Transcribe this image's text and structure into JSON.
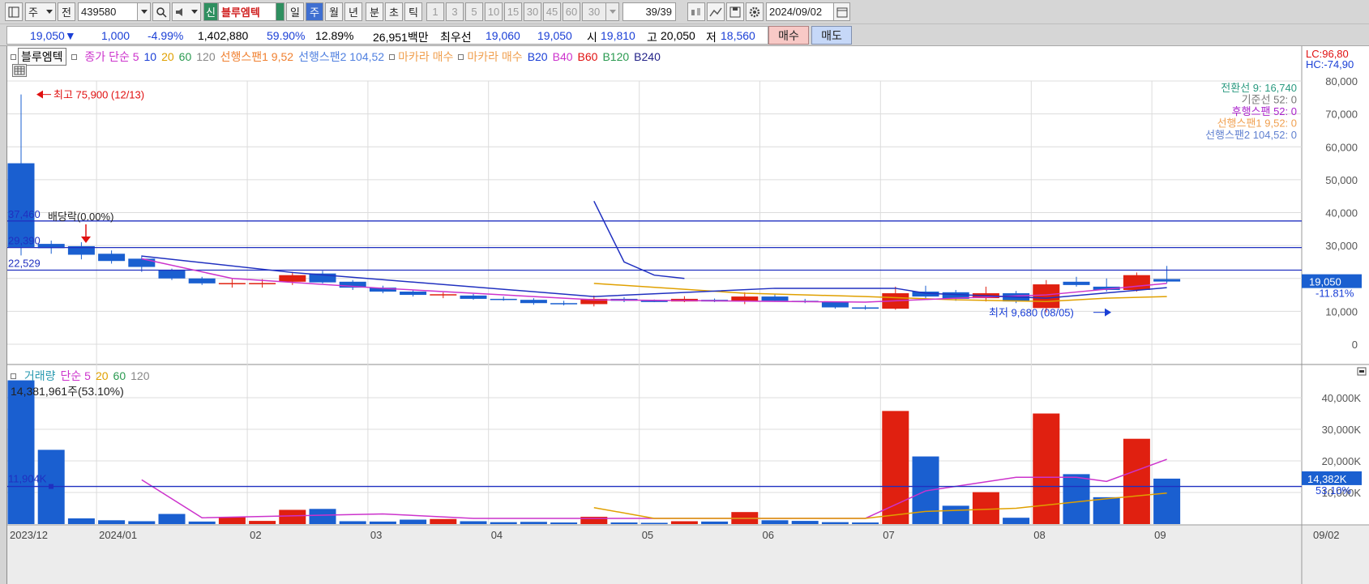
{
  "toolbar": {
    "period_select": "주",
    "prev_label": "전",
    "code": "439580",
    "badge": "신",
    "stock_name": "블루엠텍",
    "period_tabs": [
      "일",
      "주",
      "월",
      "년",
      "분",
      "초",
      "틱"
    ],
    "active_tab": "주",
    "intervals": [
      "1",
      "3",
      "5",
      "10",
      "15",
      "30",
      "45",
      "60"
    ],
    "count_select": "30",
    "page_count": "39/39",
    "date": "2024/09/02"
  },
  "info": {
    "price": "19,050▼",
    "change": "1,000",
    "change_pct": "-4.99%",
    "volume": "1,402,880",
    "ratio1": "59.90%",
    "ratio2": "12.89%",
    "amount": "26,951백만",
    "best_label": "최우선",
    "best_ask": "19,060",
    "best_bid": "19,050",
    "open_label": "시",
    "open": "19,810",
    "high_label": "고",
    "high": "20,050",
    "low_label": "저",
    "low": "18,560",
    "buy_button": "매수",
    "sell_button": "매도"
  },
  "price_legend": {
    "title": "블루엠텍",
    "items": [
      {
        "text": "종가 단순 5",
        "color": "#cc33cc"
      },
      {
        "text": "10",
        "color": "#1a3fd6"
      },
      {
        "text": "20",
        "color": "#e0a000"
      },
      {
        "text": "60",
        "color": "#2a9a50"
      },
      {
        "text": "120",
        "color": "#888888"
      },
      {
        "text": "선행스팬1 9,52",
        "color": "#f08030"
      },
      {
        "text": "선행스팬2 104,52",
        "color": "#5080e0"
      },
      {
        "text": "마카라 매수",
        "color": "#f0a050"
      },
      {
        "text": "마카라 매수",
        "color": "#f0a050"
      },
      {
        "text": "B20",
        "color": "#1a3fd6"
      },
      {
        "text": "B40",
        "color": "#cc33cc"
      },
      {
        "text": "B60",
        "color": "#e01010"
      },
      {
        "text": "B120",
        "color": "#2a9a50"
      },
      {
        "text": "B240",
        "color": "#222288"
      }
    ]
  },
  "ichimoku_legend": [
    {
      "text": "전환선 9: 16,740",
      "color": "#2a9a80"
    },
    {
      "text": "기준선 52: 0",
      "color": "#777777"
    },
    {
      "text": "후행스팬 52: 0",
      "color": "#aa22cc"
    },
    {
      "text": "선행스팬1 9,52: 0",
      "color": "#f0a050"
    },
    {
      "text": "선행스팬2 104,52: 0",
      "color": "#6080d0"
    }
  ],
  "price_scale": {
    "lc_label": "LC:96,80",
    "hc_label": "HC:-74,90",
    "ticks": [
      "80,000",
      "70,000",
      "60,000",
      "50,000",
      "40,000",
      "30,000",
      "20,000",
      "10,000",
      "0"
    ],
    "current_price": "19,050",
    "current_pct": "-11.81%"
  },
  "annotations": {
    "high": "최고 75,900 (12/13)",
    "low": "최저 9,680 (08/05)",
    "dividend": "배당락(0.00%)",
    "level1": "37,460",
    "level2": "29,390",
    "level3": "22,529"
  },
  "volume_legend": {
    "items": [
      {
        "text": "거래량",
        "color": "#2a9ab0"
      },
      {
        "text": "단순 5",
        "color": "#cc33cc"
      },
      {
        "text": "20",
        "color": "#e0a000"
      },
      {
        "text": "60",
        "color": "#2a9a50"
      },
      {
        "text": "120",
        "color": "#888888"
      }
    ],
    "value_label": "14,381,961주(53.10%)",
    "avg_label": "11,904K"
  },
  "volume_scale": {
    "ticks": [
      "40,000K",
      "30,000K",
      "20,000K",
      "10,000K"
    ],
    "current": "14,382K",
    "current_pct": "53.10%"
  },
  "x_labels": [
    "2023/12",
    "2024/01",
    "02",
    "03",
    "04",
    "05",
    "06",
    "07",
    "08",
    "09"
  ],
  "x_axis_date": "09/02",
  "colors": {
    "up": "#e02010",
    "down": "#1a5fd0",
    "grid": "#dcdcdc"
  },
  "chart_data": {
    "type": "candlestick",
    "period": "weekly",
    "candles": [
      {
        "o": 55000,
        "h": 75900,
        "l": 27000,
        "c": 29500,
        "v": 45500
      },
      {
        "o": 30500,
        "h": 31500,
        "l": 27500,
        "c": 29200,
        "v": 23500
      },
      {
        "o": 29800,
        "h": 31000,
        "l": 25800,
        "c": 27200,
        "v": 1800
      },
      {
        "o": 27500,
        "h": 28500,
        "l": 24500,
        "c": 25300,
        "v": 1200
      },
      {
        "o": 26000,
        "h": 27000,
        "l": 22000,
        "c": 23500,
        "v": 900
      },
      {
        "o": 22500,
        "h": 23000,
        "l": 19500,
        "c": 20000,
        "v": 3200
      },
      {
        "o": 20000,
        "h": 20500,
        "l": 18000,
        "c": 18500,
        "v": 800
      },
      {
        "o": 18500,
        "h": 19800,
        "l": 17200,
        "c": 18600,
        "v": 2200
      },
      {
        "o": 18500,
        "h": 19800,
        "l": 17200,
        "c": 18600,
        "v": 1000
      },
      {
        "o": 19000,
        "h": 22000,
        "l": 18000,
        "c": 21000,
        "v": 4500
      },
      {
        "o": 21500,
        "h": 22300,
        "l": 18500,
        "c": 18800,
        "v": 4800
      },
      {
        "o": 19000,
        "h": 19500,
        "l": 16500,
        "c": 17200,
        "v": 900
      },
      {
        "o": 17200,
        "h": 17800,
        "l": 15500,
        "c": 16000,
        "v": 800
      },
      {
        "o": 16000,
        "h": 16500,
        "l": 14500,
        "c": 15000,
        "v": 1400
      },
      {
        "o": 15000,
        "h": 15800,
        "l": 14000,
        "c": 15200,
        "v": 1600
      },
      {
        "o": 14800,
        "h": 15300,
        "l": 13500,
        "c": 13800,
        "v": 900
      },
      {
        "o": 13800,
        "h": 14500,
        "l": 13200,
        "c": 13500,
        "v": 600
      },
      {
        "o": 13500,
        "h": 14000,
        "l": 12000,
        "c": 12500,
        "v": 700
      },
      {
        "o": 12500,
        "h": 13200,
        "l": 11800,
        "c": 12200,
        "v": 500
      },
      {
        "o": 12200,
        "h": 14800,
        "l": 11500,
        "c": 13800,
        "v": 2300
      },
      {
        "o": 13800,
        "h": 14300,
        "l": 12800,
        "c": 13200,
        "v": 500
      },
      {
        "o": 13200,
        "h": 13600,
        "l": 12800,
        "c": 13000,
        "v": 400
      },
      {
        "o": 13000,
        "h": 14600,
        "l": 12800,
        "c": 13800,
        "v": 900
      },
      {
        "o": 13500,
        "h": 13900,
        "l": 12800,
        "c": 13000,
        "v": 800
      },
      {
        "o": 13000,
        "h": 15800,
        "l": 12200,
        "c": 14500,
        "v": 3800
      },
      {
        "o": 14500,
        "h": 15200,
        "l": 13000,
        "c": 13200,
        "v": 1200
      },
      {
        "o": 13200,
        "h": 13800,
        "l": 12500,
        "c": 12800,
        "v": 1000
      },
      {
        "o": 12800,
        "h": 13000,
        "l": 10800,
        "c": 11200,
        "v": 600
      },
      {
        "o": 11200,
        "h": 11800,
        "l": 10500,
        "c": 10800,
        "v": 500
      },
      {
        "o": 10800,
        "h": 17500,
        "l": 10500,
        "c": 15500,
        "v": 35800
      },
      {
        "o": 16000,
        "h": 17800,
        "l": 13500,
        "c": 14500,
        "v": 21400
      },
      {
        "o": 15800,
        "h": 16500,
        "l": 13200,
        "c": 13800,
        "v": 5800
      },
      {
        "o": 14000,
        "h": 17500,
        "l": 13000,
        "c": 15500,
        "v": 10100
      },
      {
        "o": 15500,
        "h": 16200,
        "l": 12500,
        "c": 13000,
        "v": 2000
      },
      {
        "o": 11000,
        "h": 19500,
        "l": 9680,
        "c": 18200,
        "v": 35000
      },
      {
        "o": 19000,
        "h": 20500,
        "l": 17500,
        "c": 18000,
        "v": 15800
      },
      {
        "o": 17500,
        "h": 20000,
        "l": 16000,
        "c": 16500,
        "v": 8500
      },
      {
        "o": 16500,
        "h": 21800,
        "l": 16000,
        "c": 21000,
        "v": 27000
      },
      {
        "o": 19810,
        "h": 23800,
        "l": 18560,
        "c": 19050,
        "v": 14382
      }
    ],
    "h_lines": [
      37460,
      29390,
      22529
    ],
    "ma_blue": [
      [
        4,
        26800
      ],
      [
        9,
        21800
      ],
      [
        19,
        14500
      ],
      [
        25,
        17000
      ],
      [
        29,
        17000
      ],
      [
        30,
        15500
      ],
      [
        34,
        14000
      ],
      [
        38,
        17200
      ]
    ],
    "ma_blue_spike": [
      [
        19,
        43500
      ],
      [
        20,
        25000
      ],
      [
        21,
        21000
      ],
      [
        22,
        20000
      ]
    ],
    "ma_magenta": [
      [
        4,
        26000
      ],
      [
        7,
        20000
      ],
      [
        12,
        17000
      ],
      [
        19,
        13500
      ],
      [
        28,
        12800
      ],
      [
        31,
        14000
      ],
      [
        34,
        15000
      ],
      [
        38,
        18500
      ]
    ],
    "ma_orange": [
      [
        19,
        18500
      ],
      [
        24,
        15500
      ],
      [
        28,
        14500
      ],
      [
        31,
        13500
      ],
      [
        34,
        13000
      ],
      [
        36,
        14000
      ],
      [
        38,
        14500
      ]
    ],
    "vol_ma_magenta": [
      [
        4,
        14000
      ],
      [
        6,
        2000
      ],
      [
        12,
        3200
      ],
      [
        15,
        1800
      ],
      [
        28,
        1800
      ],
      [
        30,
        10500
      ],
      [
        33,
        14800
      ],
      [
        35,
        14800
      ],
      [
        36,
        13500
      ],
      [
        38,
        20500
      ]
    ],
    "vol_ma_orange": [
      [
        19,
        5200
      ],
      [
        21,
        1800
      ],
      [
        28,
        1800
      ],
      [
        30,
        4000
      ],
      [
        33,
        5000
      ],
      [
        36,
        8000
      ],
      [
        38,
        9800
      ]
    ],
    "vol_avg_line": 11904,
    "price_ylim": [
      0,
      80000
    ],
    "vol_ylim": [
      0,
      40000
    ]
  }
}
